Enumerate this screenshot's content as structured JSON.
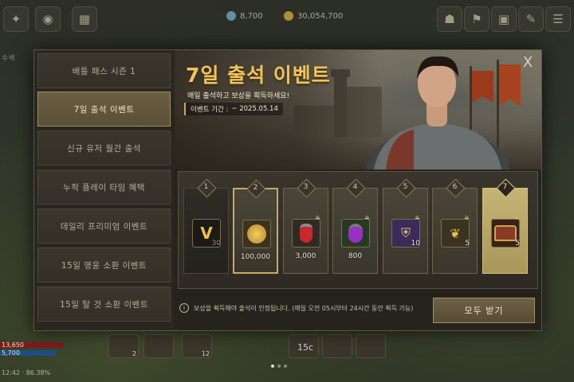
{
  "hud": {
    "currency_1": "8,700",
    "currency_2": "30,054,700",
    "left_label": "수색",
    "hp_text": "13,650",
    "mp_text": "5,700",
    "coords_text": "12:42 · 86.38%",
    "slot_counts": [
      "2",
      "",
      "12",
      "15c"
    ]
  },
  "sidebar": {
    "items": [
      {
        "label": "배틀 패스 시즌 1"
      },
      {
        "label": "7일 출석 이벤트"
      },
      {
        "label": "신규 유저 월간 출석"
      },
      {
        "label": "누적 플레이 타임 혜택"
      },
      {
        "label": "데일리 프리미엄 이벤트"
      },
      {
        "label": "15일 영웅 소환 이벤트"
      },
      {
        "label": "15일 탈 것 소환 이벤트"
      }
    ],
    "active_index": 1
  },
  "banner": {
    "title": "7일 출석 이벤트",
    "subtitle": "매일 출석하고 보상을 획득하세요!",
    "period_label": "이벤트 기간 :",
    "period_value": "~ 2025.05.14"
  },
  "close_label": "X",
  "rewards": [
    {
      "day": "1",
      "qty": "30",
      "icon": "v-ticket",
      "state": "received",
      "color": "#1c1a16"
    },
    {
      "day": "2",
      "qty": "100,000",
      "icon": "gold-coin",
      "state": "today",
      "color": "#3b3222"
    },
    {
      "day": "3",
      "qty": "3,000",
      "icon": "red-potion",
      "state": "locked",
      "color": "#2f2a23"
    },
    {
      "day": "4",
      "qty": "800",
      "icon": "purple-potion",
      "state": "locked",
      "color": "#263a22"
    },
    {
      "day": "5",
      "qty": "10",
      "icon": "helmet-book",
      "state": "locked",
      "color": "#3b2a5a"
    },
    {
      "day": "6",
      "qty": "5",
      "icon": "gold-card",
      "state": "locked",
      "color": "#3a3322"
    },
    {
      "day": "7",
      "qty": "5",
      "icon": "treasure-chest",
      "state": "final",
      "color": "#3a2218"
    }
  ],
  "footer": {
    "note": "보상을 획득해야 출석이 인정됩니다. (매일 오전 05시부터 24시간 동안 획득 가능)",
    "claim_all": "모두 받기"
  },
  "colors": {
    "accent_gold": "#f0c45e",
    "active_tab": "#6a5f43"
  }
}
